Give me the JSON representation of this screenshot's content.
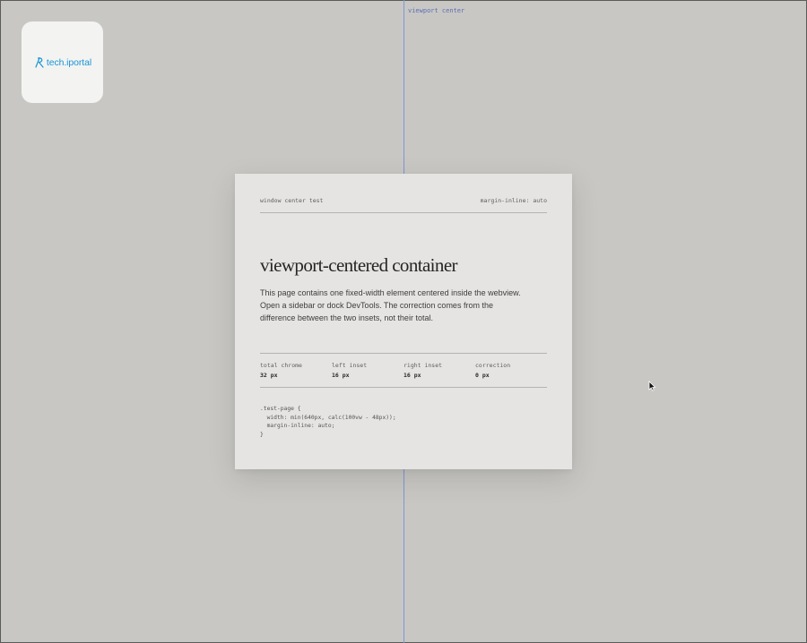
{
  "overlay": {
    "center_label": "viewport center"
  },
  "logo": {
    "text": "tech.iportal",
    "color": "#1896d4"
  },
  "card": {
    "header_left": "window center test",
    "header_right": "margin-inline: auto",
    "title": "viewport-centered container",
    "description": "This page contains one fixed-width element centered inside the webview. Open a sidebar or dock DevTools. The correction comes from the difference between the two insets, not their total.",
    "stats": [
      {
        "label": "total chrome",
        "value": "32 px"
      },
      {
        "label": "left inset",
        "value": "16 px"
      },
      {
        "label": "right inset",
        "value": "16 px"
      },
      {
        "label": "correction",
        "value": "0 px"
      }
    ],
    "code": ".test-page {\n  width: min(640px, calc(100vw - 48px));\n  margin-inline: auto;\n}"
  },
  "colors": {
    "background": "#c8c7c3",
    "card": "#e5e4e3",
    "center_line": "#7f97d6"
  },
  "icons": {
    "cursor": "mouse-pointer-icon"
  }
}
